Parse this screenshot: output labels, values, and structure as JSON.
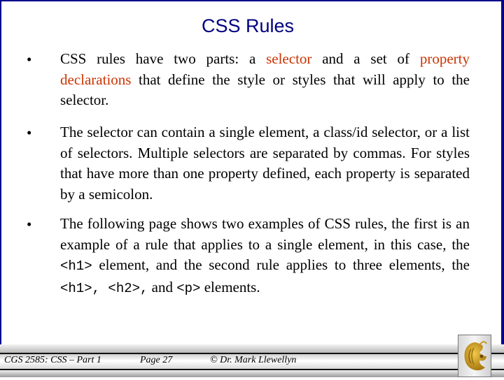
{
  "slide": {
    "title": "CSS Rules",
    "bullet_glyph": "•",
    "bullets": [
      {
        "segments": [
          {
            "text": "CSS rules have two parts:  a ",
            "style": "normal"
          },
          {
            "text": "selector",
            "style": "highlight"
          },
          {
            "text": " and a set of ",
            "style": "normal"
          },
          {
            "text": "property declarations",
            "style": "highlight"
          },
          {
            "text": " that define the style or styles that will apply to the selector.",
            "style": "normal"
          }
        ]
      },
      {
        "segments": [
          {
            "text": "The selector can contain a single element, a class/id selector, or a list of selectors.  Multiple selectors are separated by commas.  For styles that have more than one property defined, each property is separated by a semicolon.",
            "style": "normal"
          }
        ]
      },
      {
        "segments": [
          {
            "text": "The following page shows two examples of CSS rules, the first is an example of a rule that applies to a single element, in this case, the ",
            "style": "normal"
          },
          {
            "text": "<h1>",
            "style": "code"
          },
          {
            "text": " element, and the second rule applies to three elements, the ",
            "style": "normal"
          },
          {
            "text": "<h1>,  <h2>,",
            "style": "code"
          },
          {
            "text": " and ",
            "style": "normal"
          },
          {
            "text": "<p>",
            "style": "code"
          },
          {
            "text": " elements.",
            "style": "normal"
          }
        ]
      }
    ]
  },
  "footer": {
    "course": "CGS 2585: CSS – Part 1",
    "page": "Page 27",
    "author": "© Dr. Mark Llewellyn",
    "logo_icon": "ucf-pegasus-logo-icon"
  },
  "colors": {
    "title": "#000080",
    "highlight": "#cc3300",
    "border": "#00008b",
    "logo_gold": "#c99a1c"
  }
}
